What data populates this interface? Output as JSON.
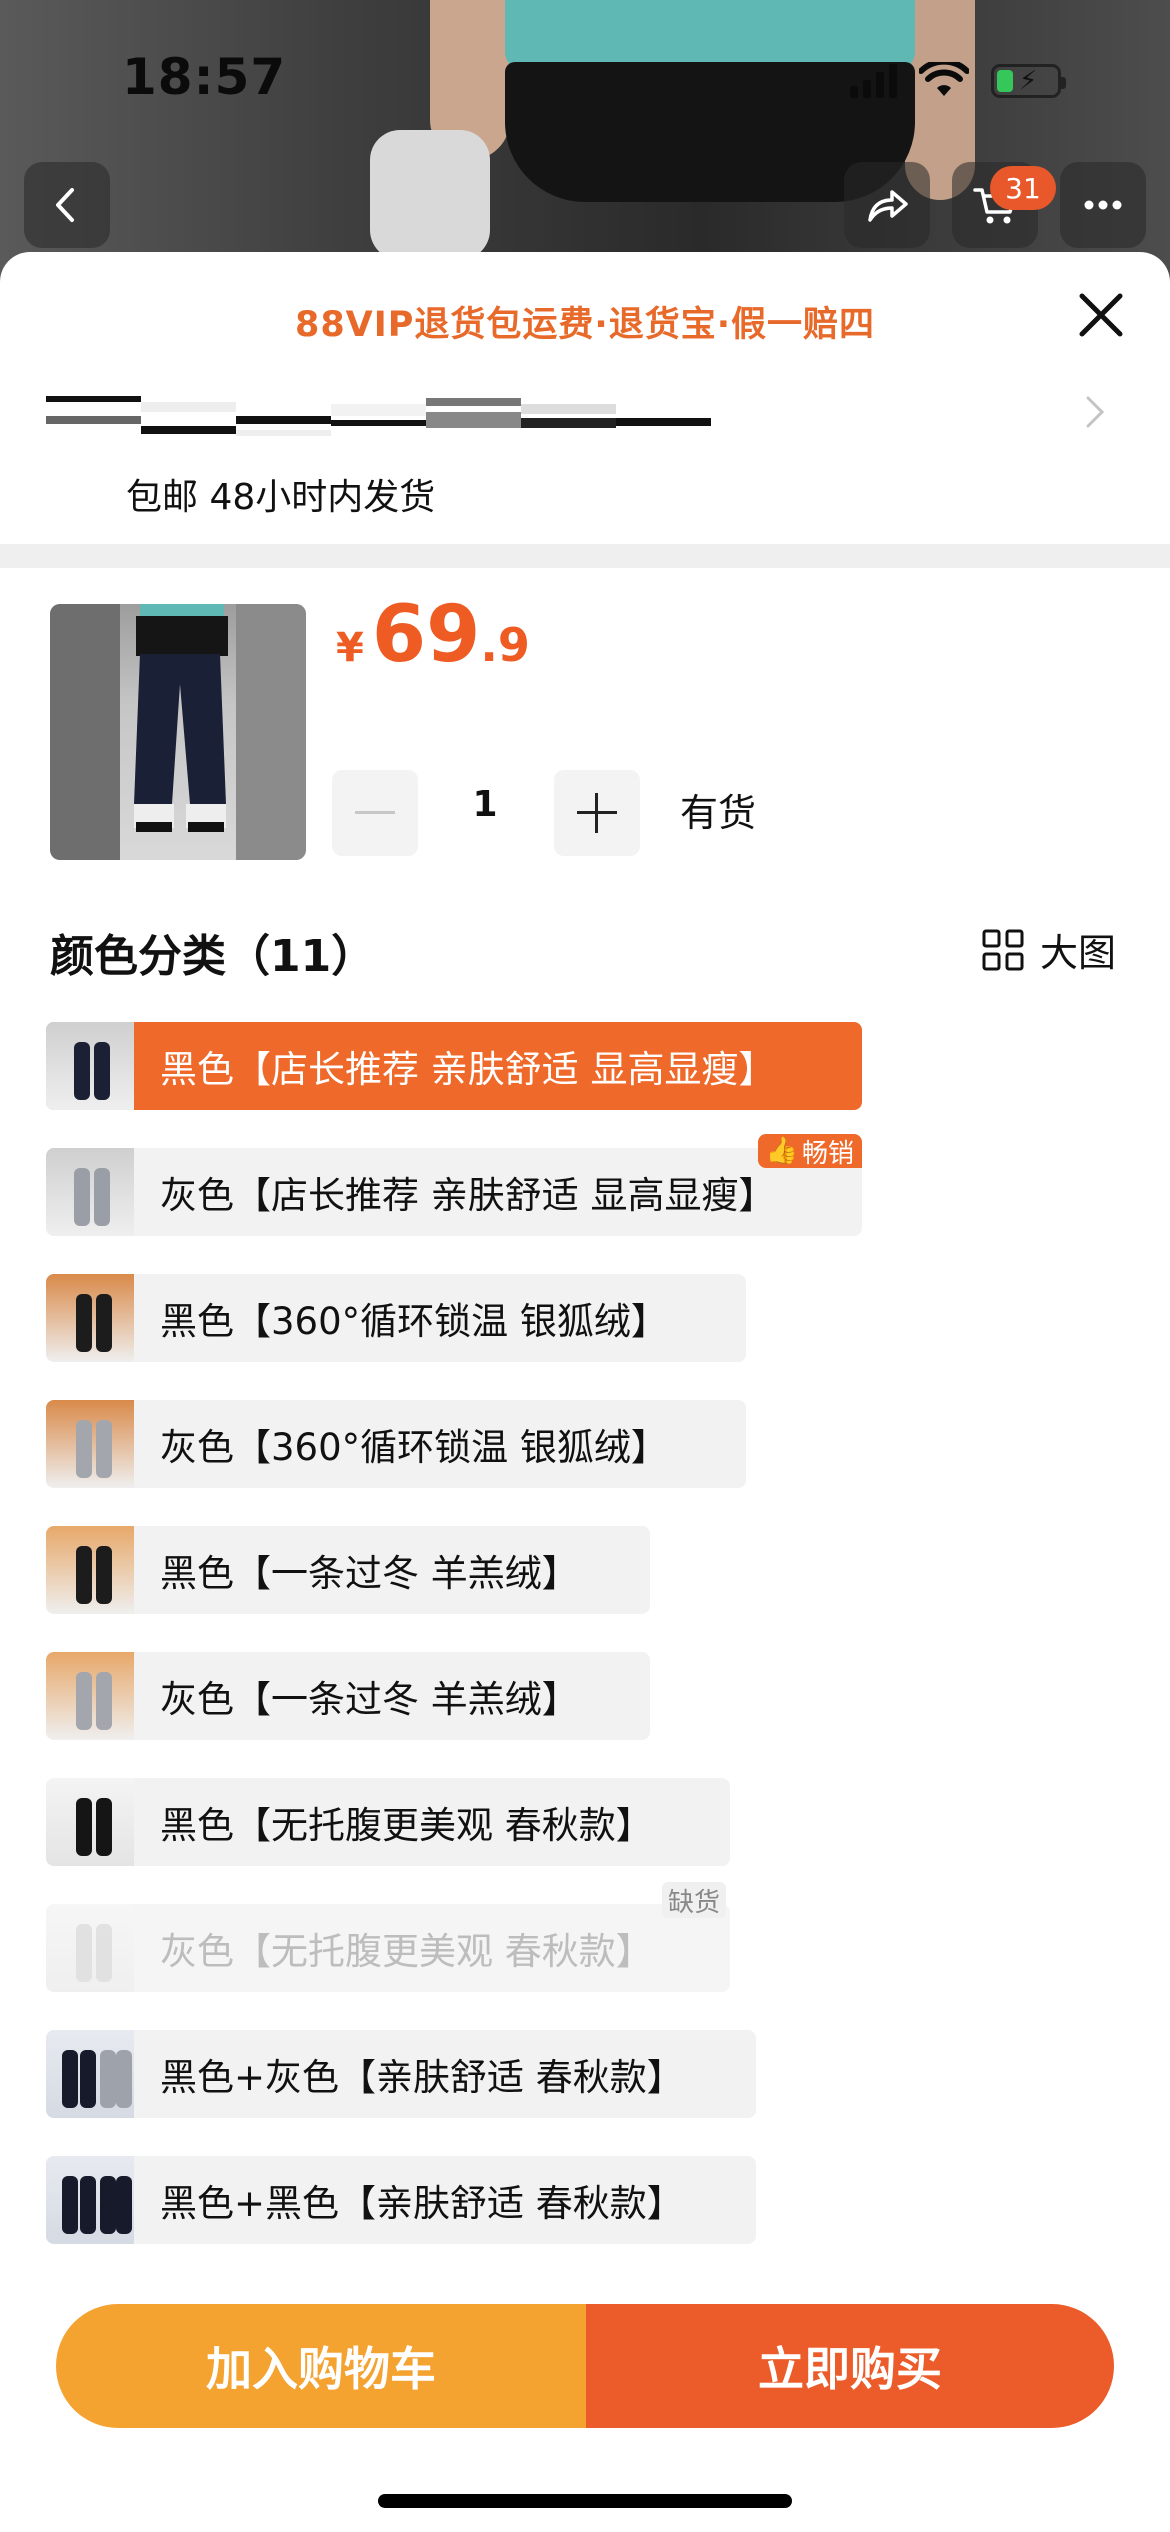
{
  "status_bar": {
    "time": "18:57"
  },
  "nav": {
    "cart_count": "31"
  },
  "sheet": {
    "promo": "88VIP退货包运费·退货宝·假一赔四",
    "shipping": "包邮 48小时内发货"
  },
  "product": {
    "currency": "¥",
    "price_int": "69",
    "price_dec": ".9",
    "quantity": "1",
    "stock_status": "有货"
  },
  "variants": {
    "title": "颜色分类（11）",
    "big_view_label": "大图",
    "hot_tag": "畅销",
    "out_of_stock_tag": "缺货",
    "items": [
      {
        "label": "黑色【店长推荐 亲肤舒适 显高显瘦】"
      },
      {
        "label": "灰色【店长推荐 亲肤舒适 显高显瘦】"
      },
      {
        "label": "黑色【360°循环锁温 银狐绒】"
      },
      {
        "label": "灰色【360°循环锁温 银狐绒】"
      },
      {
        "label": "黑色【一条过冬 羊羔绒】"
      },
      {
        "label": "灰色【一条过冬 羊羔绒】"
      },
      {
        "label": "黑色【无托腹更美观 春秋款】"
      },
      {
        "label": "灰色【无托腹更美观 春秋款】"
      },
      {
        "label": "黑色+灰色【亲肤舒适 春秋款】"
      },
      {
        "label": "黑色+黑色【亲肤舒适 春秋款】"
      }
    ]
  },
  "actions": {
    "add_to_cart": "加入购物车",
    "buy_now": "立即购买"
  },
  "colors": {
    "accent": "#ef6a2a",
    "cart_button": "#f4a230",
    "buy_button": "#ec5c2a"
  }
}
